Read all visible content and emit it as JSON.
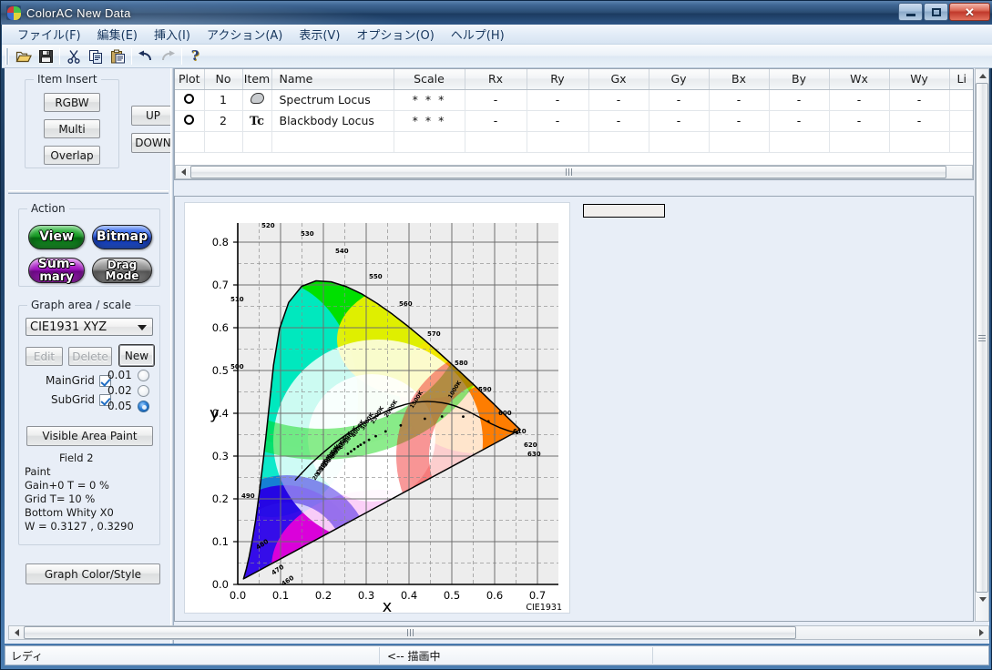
{
  "window": {
    "title": "ColorAC  New Data",
    "icon": "colorac-app-icon",
    "buttons": {
      "minimize": "minimize",
      "restore": "restore",
      "close": "close"
    }
  },
  "menubar": {
    "items": [
      {
        "label": "ファイル(F)",
        "name": "menu-file"
      },
      {
        "label": "編集(E)",
        "name": "menu-edit"
      },
      {
        "label": "挿入(I)",
        "name": "menu-insert"
      },
      {
        "label": "アクション(A)",
        "name": "menu-action"
      },
      {
        "label": "表示(V)",
        "name": "menu-view"
      },
      {
        "label": "オプション(O)",
        "name": "menu-options"
      },
      {
        "label": "ヘルプ(H)",
        "name": "menu-help"
      }
    ]
  },
  "toolbar": {
    "buttons": [
      {
        "icon": "open-folder-icon",
        "enabled": true
      },
      {
        "icon": "save-floppy-icon",
        "enabled": true
      },
      {
        "icon": "cut-scissors-icon",
        "enabled": true
      },
      {
        "icon": "copy-icon",
        "enabled": true
      },
      {
        "icon": "paste-icon",
        "enabled": true
      },
      {
        "icon": "undo-icon",
        "enabled": true
      },
      {
        "icon": "redo-icon",
        "enabled": false
      },
      {
        "icon": "help-question-icon",
        "enabled": true
      }
    ]
  },
  "sidebar": {
    "item_insert": {
      "title": "Item Insert",
      "rgbw": "RGBW",
      "multi": "Multi",
      "overlap": "Overlap",
      "up": "UP",
      "down": "DOWN"
    },
    "action": {
      "title": "Action",
      "view": "View",
      "bitmap": "Bitmap",
      "summary_l1": "Sum-",
      "summary_l2": "mary",
      "drag_l1": "Drag",
      "drag_l2": "Mode",
      "colors": {
        "view": "#179a24",
        "bitmap": "#1a4fe0",
        "summary": "#a215c0",
        "drag": "#8e8e8e"
      }
    },
    "graph_area": {
      "title": "Graph area / scale",
      "scale_selected": "CIE1931 XYZ",
      "scale_options": [
        "CIE1931 XYZ"
      ],
      "edit": "Edit",
      "delete": "Delete",
      "new": "New",
      "edit_enabled": false,
      "delete_enabled": false,
      "maingrid_label": "MainGrid",
      "maingrid_checked": true,
      "subgrid_label": "SubGrid",
      "subgrid_checked": true,
      "grid_steps": [
        "0.01",
        "0.02",
        "0.05"
      ],
      "grid_step_selected": "0.05",
      "visible_area_paint": "Visible Area Paint",
      "info": [
        "Field 2",
        "Paint",
        " Gain+0  T =   0 %",
        "Grid T= 10 %",
        "Bottom  Whity X0",
        " W = 0.3127 , 0.3290"
      ],
      "graph_color_style": "Graph Color/Style"
    }
  },
  "table": {
    "columns": [
      "Plot",
      "No",
      "Item",
      "Name",
      "Scale",
      "Rx",
      "Ry",
      "Gx",
      "Gy",
      "Bx",
      "By",
      "Wx",
      "Wy",
      "Li"
    ],
    "rows": [
      {
        "plot": "radio-circle-icon",
        "no": "1",
        "item_icon": "spectrum-locus-icon",
        "item_text": "",
        "name": "Spectrum Locus",
        "scale": "* * *",
        "rx": "-",
        "ry": "-",
        "gx": "-",
        "gy": "-",
        "bx": "-",
        "by": "-",
        "wx": "-",
        "wy": "-",
        "li": ""
      },
      {
        "plot": "radio-circle-icon",
        "no": "2",
        "item_icon": "tc-icon",
        "item_text": "Tc",
        "name": "Blackbody Locus",
        "scale": "* * *",
        "rx": "-",
        "ry": "-",
        "gx": "-",
        "gy": "-",
        "bx": "-",
        "by": "-",
        "wx": "-",
        "wy": "-",
        "li": ""
      }
    ]
  },
  "chart_data": {
    "type": "scatter",
    "title": "",
    "annotation": "CIE1931",
    "xlabel": "x",
    "ylabel": "y",
    "xlim": [
      0.0,
      0.75
    ],
    "ylim": [
      0.0,
      0.85
    ],
    "xticks": [
      "0.0",
      "0.1",
      "0.2",
      "0.3",
      "0.4",
      "0.5",
      "0.6",
      "0.7"
    ],
    "yticks": [
      "0.0",
      "0.1",
      "0.2",
      "0.3",
      "0.4",
      "0.5",
      "0.6",
      "0.7",
      "0.8"
    ],
    "grid": true,
    "grid_main_step": 0.1,
    "grid_sub_step": 0.05,
    "legend_position": "none",
    "series": [
      {
        "name": "Spectrum Locus",
        "type": "closed-curve",
        "wavelength_labels": [
          {
            "nm": "460",
            "x": 0.144,
            "y": 0.0297
          },
          {
            "nm": "470",
            "x": 0.1241,
            "y": 0.0578
          },
          {
            "nm": "480",
            "x": 0.0913,
            "y": 0.1327
          },
          {
            "nm": "490",
            "x": 0.0454,
            "y": 0.295
          },
          {
            "nm": "500",
            "x": 0.0082,
            "y": 0.5384
          },
          {
            "nm": "510",
            "x": 0.0139,
            "y": 0.7502
          },
          {
            "nm": "520",
            "x": 0.0743,
            "y": 0.8338
          },
          {
            "nm": "530",
            "x": 0.1547,
            "y": 0.8059
          },
          {
            "nm": "540",
            "x": 0.2296,
            "y": 0.7543
          },
          {
            "nm": "550",
            "x": 0.3016,
            "y": 0.6923
          },
          {
            "nm": "560",
            "x": 0.3731,
            "y": 0.6245
          },
          {
            "nm": "570",
            "x": 0.4441,
            "y": 0.5547
          },
          {
            "nm": "580",
            "x": 0.5125,
            "y": 0.4866
          },
          {
            "nm": "590",
            "x": 0.5752,
            "y": 0.4242
          },
          {
            "nm": "600",
            "x": 0.627,
            "y": 0.3725
          },
          {
            "nm": "610",
            "x": 0.6658,
            "y": 0.334
          },
          {
            "nm": "620",
            "x": 0.6915,
            "y": 0.3083
          },
          {
            "nm": "630",
            "x": 0.7079,
            "y": 0.292
          }
        ]
      },
      {
        "name": "Blackbody Locus",
        "type": "curve",
        "temperature_labels": [
          {
            "k": "1000K",
            "x": 0.6528,
            "y": 0.3444
          },
          {
            "k": "1500K",
            "x": 0.5857,
            "y": 0.3931
          },
          {
            "k": "2000K",
            "x": 0.5267,
            "y": 0.4133
          },
          {
            "k": "2500K",
            "x": 0.477,
            "y": 0.4137
          },
          {
            "k": "3000K",
            "x": 0.4369,
            "y": 0.4041
          },
          {
            "k": "4000K",
            "x": 0.3805,
            "y": 0.3768
          },
          {
            "k": "5000K",
            "x": 0.3451,
            "y": 0.3516
          },
          {
            "k": "6000K",
            "x": 0.3221,
            "y": 0.3318
          },
          {
            "k": "7000K",
            "x": 0.3064,
            "y": 0.3166
          },
          {
            "k": "8000K",
            "x": 0.2952,
            "y": 0.3048
          },
          {
            "k": "9000K",
            "x": 0.2869,
            "y": 0.2956
          },
          {
            "k": "10000K",
            "x": 0.2807,
            "y": 0.2884
          },
          {
            "k": "12000K",
            "x": 0.2722,
            "y": 0.278
          },
          {
            "k": "15000K",
            "x": 0.2645,
            "y": 0.2682
          },
          {
            "k": "20000K",
            "x": 0.2574,
            "y": 0.2583
          }
        ]
      }
    ]
  },
  "statusbar": {
    "ready": "レディ",
    "drawing": "<-- 描画中"
  },
  "scrollbars": {
    "table_h": "table-horizontal-scrollbar",
    "client_v": "client-vertical-scrollbar",
    "client_h": "client-horizontal-scrollbar"
  }
}
